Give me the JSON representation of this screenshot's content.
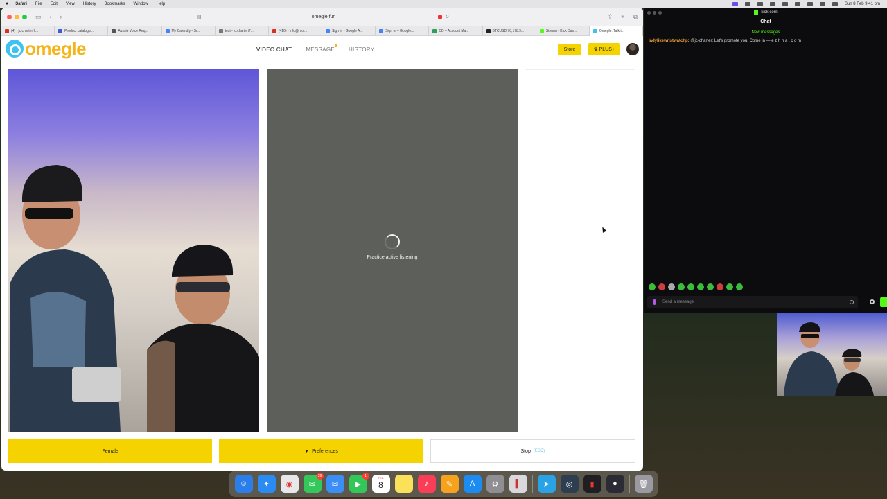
{
  "menubar": {
    "app": "Safari",
    "items": [
      "File",
      "Edit",
      "View",
      "History",
      "Bookmarks",
      "Window",
      "Help"
    ],
    "datetime": "Sun 8 Feb  9:41 pm"
  },
  "browser": {
    "url": "omegle.fun",
    "tabs": [
      {
        "title": "(4) · jc.charteri7...",
        "color": "#d93025"
      },
      {
        "title": "Product catalogu...",
        "color": "#3b5bdb"
      },
      {
        "title": "Aussie Voice Req...",
        "color": "#555555"
      },
      {
        "title": "My Calendly - Sc...",
        "color": "#4285f4"
      },
      {
        "title": "test - jc.charteri7...",
        "color": "#777777"
      },
      {
        "title": "(416) - info@mol...",
        "color": "#d93025"
      },
      {
        "title": "Sign in - Google A...",
        "color": "#4285f4"
      },
      {
        "title": "Sign in – Google...",
        "color": "#4285f4"
      },
      {
        "title": "CD – Account Ma...",
        "color": "#2e9e5b"
      },
      {
        "title": "BTCUSD 70,178.9...",
        "color": "#222222"
      },
      {
        "title": "Stream - Kick Das...",
        "color": "#53fc18"
      },
      {
        "title": "Omegle: Talk t...",
        "color": "#3ec3f0"
      }
    ]
  },
  "site": {
    "logo": "omegle",
    "nav": [
      "VIDEO CHAT",
      "MESSAGE",
      "HISTORY"
    ],
    "store": "Store",
    "plus": "♛ PLUS+",
    "status": "Practice active listening",
    "buttons": {
      "gender": "Female",
      "preferences": "Preferences",
      "stop": "Stop",
      "stop_hint": "(ESC)"
    }
  },
  "kick": {
    "window_title": "kick.com",
    "title": "Chat",
    "new_messages": "New messages",
    "message": {
      "user": "ladylikewristwatchp:",
      "text": " @jc-charter: Let's promote you. Come in — e z h n a . c o m"
    },
    "placeholder": "Send a message"
  },
  "dock": {
    "messages_badge": "39",
    "facetime_badge": "1",
    "calendar_month": "FEB",
    "calendar_day": "8"
  }
}
